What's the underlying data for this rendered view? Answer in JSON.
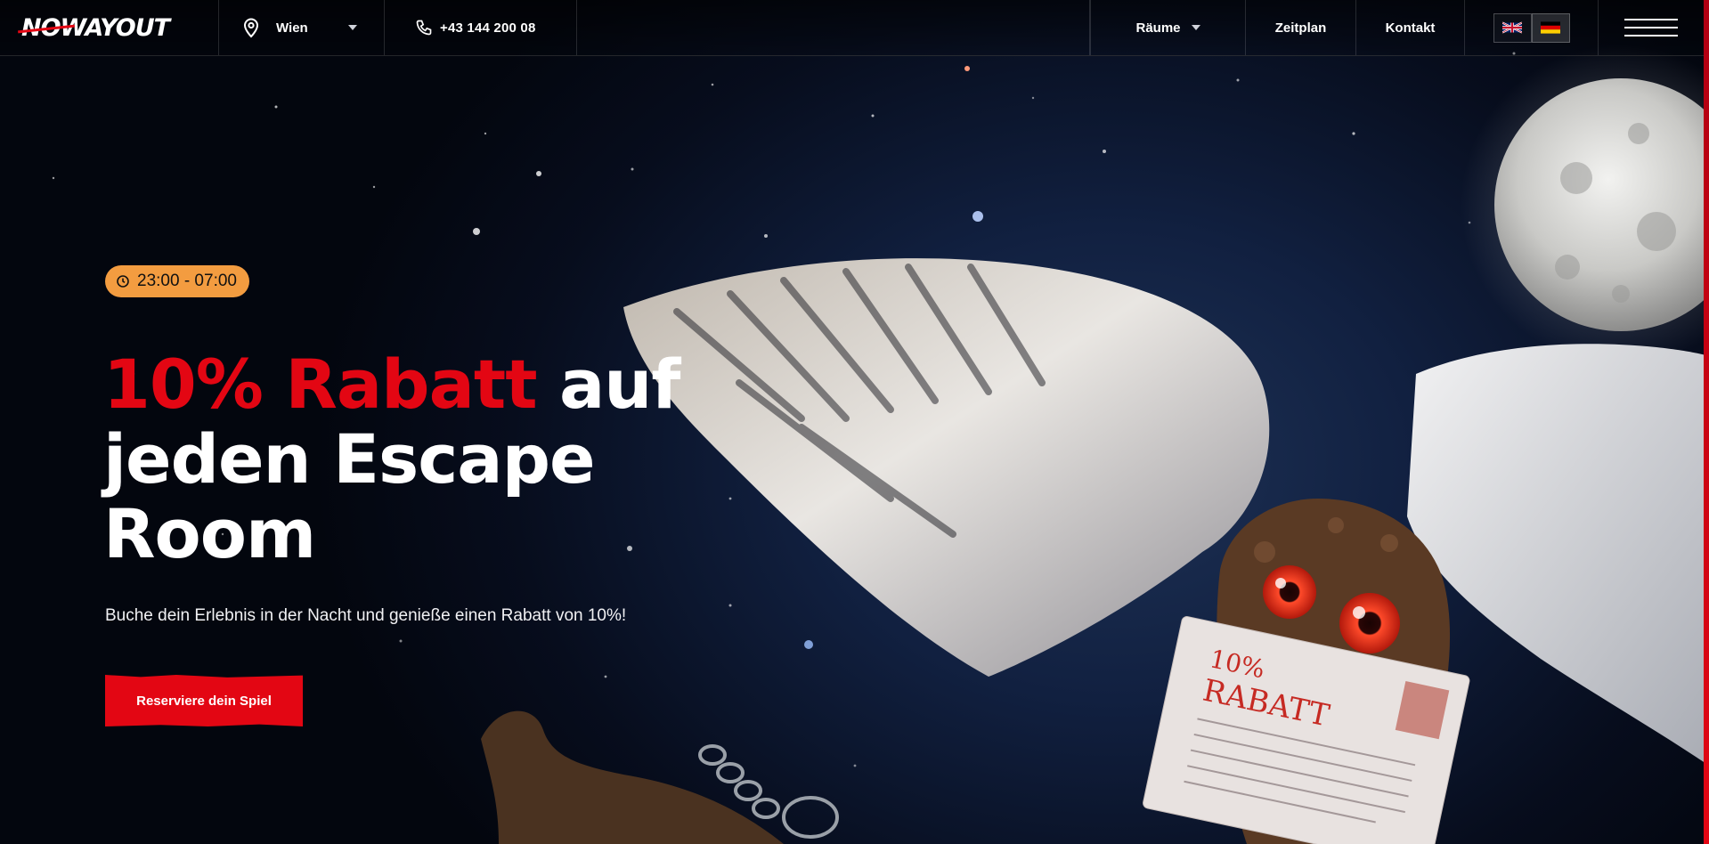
{
  "nav": {
    "logo_text": "NOWAYOUT",
    "city": "Wien",
    "phone": "+43 144 200 08",
    "rooms": "Räume",
    "schedule": "Zeitplan",
    "contact": "Kontakt",
    "languages": [
      {
        "code": "en",
        "flag": "uk-flag-icon",
        "active": false
      },
      {
        "code": "de",
        "flag": "germany-flag-icon",
        "active": true
      }
    ]
  },
  "hero": {
    "hours": "23:00 - 07:00",
    "headline_highlight": "10% Rabatt",
    "headline_rest": " auf jeden Escape Room",
    "subtitle": "Buche dein Erlebnis in der Nacht und genieße einen Rabatt von 10%!",
    "cta": "Reserviere dein Spiel",
    "letter_line1": "10%",
    "letter_line2": "RABATT"
  },
  "colors": {
    "accent": "#e30613",
    "badge": "#f39c40",
    "background": "#070d1d"
  }
}
